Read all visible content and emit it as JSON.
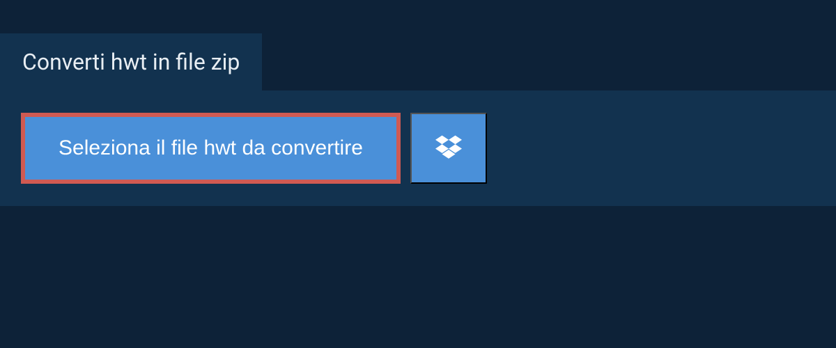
{
  "header": {
    "title": "Converti hwt in file zip"
  },
  "actions": {
    "select_file_label": "Seleziona il file hwt da convertire",
    "dropbox_icon_name": "dropbox"
  },
  "colors": {
    "background": "#0d2238",
    "panel": "#12324f",
    "button_primary": "#4a90d9",
    "highlight_border": "#d05a52",
    "text": "#ffffff"
  }
}
